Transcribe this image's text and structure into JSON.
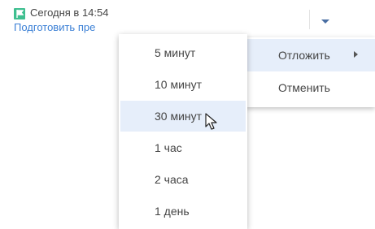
{
  "header": {
    "flag_icon": "flag-icon",
    "reminder_time": "Сегодня в 14:54",
    "task_link": "Подготовить пре",
    "flag_color": "#3fbf90",
    "link_color": "#3a7fd5"
  },
  "main_menu": {
    "items": [
      {
        "label": "Отложить",
        "has_submenu": true,
        "highlighted": true
      },
      {
        "label": "Отменить",
        "has_submenu": false,
        "highlighted": false
      }
    ]
  },
  "submenu": {
    "items": [
      {
        "label": "5 минут"
      },
      {
        "label": "10 минут"
      },
      {
        "label": "30 минут",
        "hovered": true
      },
      {
        "label": "1 час"
      },
      {
        "label": "2 часа"
      },
      {
        "label": "1 день"
      }
    ],
    "highlight_color": "#e6eefa"
  }
}
